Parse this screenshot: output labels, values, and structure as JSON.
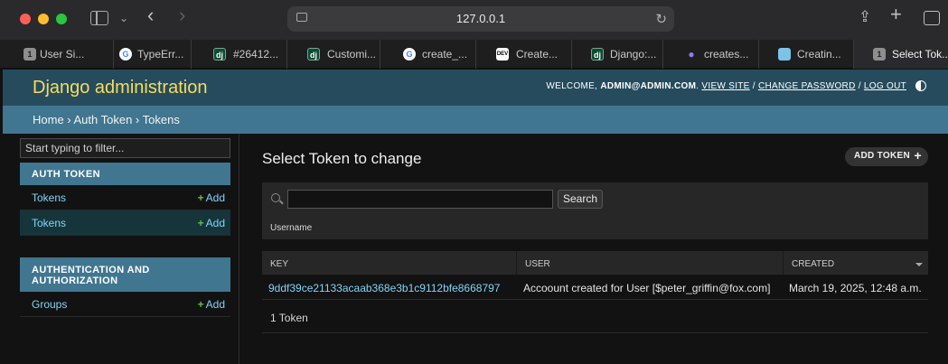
{
  "browser": {
    "url": "127.0.0.1",
    "tabs": [
      {
        "label": "User Si...",
        "favicon": "1",
        "active": false
      },
      {
        "label": "TypeErr...",
        "favicon": "G",
        "active": false
      },
      {
        "label": "#26412...",
        "favicon": "dj",
        "active": false
      },
      {
        "label": "Customi...",
        "favicon": "dj",
        "active": false
      },
      {
        "label": "create_...",
        "favicon": "G",
        "active": false
      },
      {
        "label": "Create...",
        "favicon": "DEV",
        "active": false
      },
      {
        "label": "Django:...",
        "favicon": "dj",
        "active": false
      },
      {
        "label": "creates...",
        "favicon": "people-icon",
        "active": false
      },
      {
        "label": "Creatin...",
        "favicon": "box-icon",
        "active": false
      },
      {
        "label": "Select Tok...",
        "favicon": "1",
        "active": true
      }
    ]
  },
  "header": {
    "branding": "Django administration",
    "welcome": "Welcome,",
    "username": "admin@admin.com",
    "view_site": "View site",
    "change_password": "Change password",
    "log_out": "Log out",
    "sep": "/"
  },
  "breadcrumbs": "Home › Auth Token › Tokens",
  "sidebar": {
    "filter_placeholder": "Start typing to filter...",
    "modules": [
      {
        "caption": "Auth Token",
        "models": [
          {
            "name": "Tokens",
            "add": "Add",
            "selected": false
          },
          {
            "name": "Tokens",
            "add": "Add",
            "selected": true
          }
        ]
      },
      {
        "caption": "Authentication and Authorization",
        "models": [
          {
            "name": "Groups",
            "add": "Add",
            "selected": false
          }
        ]
      }
    ]
  },
  "content": {
    "title": "Select Token to change",
    "add_button": "Add Token",
    "search_button": "Search",
    "search_value": "",
    "filter_label": "Username",
    "columns": [
      "Key",
      "User",
      "Created"
    ],
    "rows": [
      {
        "key": "9ddf39ce21133acaab368e3b1c9112bfe8668797",
        "user": "Accoount created for User [$peter_griffin@fox.com]",
        "created": "March 19, 2025, 12:48 a.m."
      }
    ],
    "paginator": "1 Token"
  },
  "colors": {
    "header_bg": "#264b5d",
    "branding": "#f5dd5d",
    "breadcrumbs_bg": "#417690",
    "link": "#81d4fa",
    "add_green": "#5fbf48"
  }
}
